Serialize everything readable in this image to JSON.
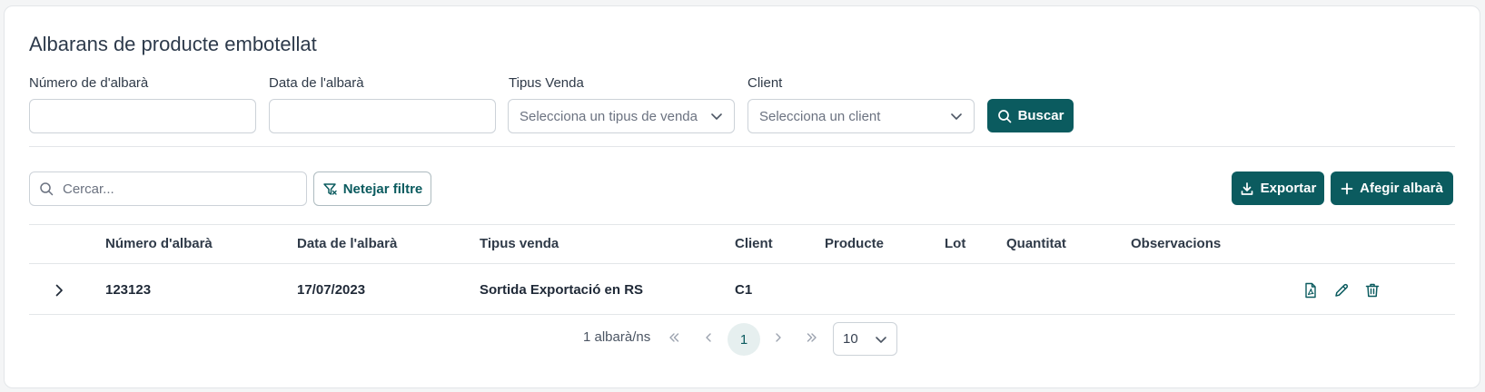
{
  "page": {
    "title": "Albarans de producte embotellat"
  },
  "filters": {
    "numero_label": "Número de d'albarà",
    "data_label": "Data de l'albarà",
    "tipus_label": "Tipus Venda",
    "tipus_placeholder": "Selecciona un tipus de venda",
    "client_label": "Client",
    "client_placeholder": "Selecciona un client",
    "search_button": "Buscar"
  },
  "toolbar": {
    "search_placeholder": "Cercar...",
    "clear_filter": "Netejar filtre",
    "export": "Exportar",
    "add": "Afegir albarà"
  },
  "table": {
    "headers": [
      "Número d'albarà",
      "Data de l'albarà",
      "Tipus venda",
      "Client",
      "Producte",
      "Lot",
      "Quantitat",
      "Observacions"
    ],
    "rows": [
      {
        "numero": "123123",
        "data": "17/07/2023",
        "tipus": "Sortida Exportació en RS",
        "client": "C1",
        "producte": "",
        "lot": "",
        "quantitat": "",
        "observacions": ""
      }
    ]
  },
  "pagination": {
    "summary": "1 albarà/ns",
    "current_page": "1",
    "page_size": "10"
  },
  "colors": {
    "accent": "#0b5b5f",
    "border": "#ccd2d8",
    "current_page_bg": "#e6efef"
  },
  "icons": [
    "search-icon",
    "filter-clear-icon",
    "download-icon",
    "plus-icon",
    "chevron-right-icon",
    "pdf-file-icon",
    "edit-pencil-icon",
    "trash-icon",
    "chevrons-left-icon",
    "chevron-left-icon",
    "chevrons-right-icon",
    "chevron-down-icon"
  ]
}
